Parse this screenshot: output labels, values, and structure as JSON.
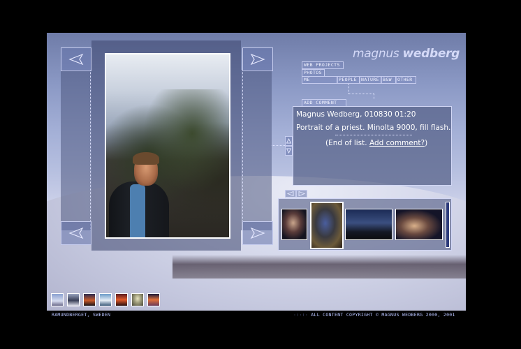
{
  "logo": {
    "first": "magnus",
    "last": "wedberg"
  },
  "nav": {
    "web_projects": "WEB PROJECTS",
    "photos": "PHOTOS",
    "me": "ME",
    "people": "PEOPLE",
    "nature": "NATURE",
    "bw": "B&W",
    "other": "OTHER",
    "add_comment": "ADD COMMENT"
  },
  "comment": {
    "author_date": "Magnus Wedberg, 010830 01:20",
    "text": "Portrait of a priest. Minolta 9000, fill flash.",
    "end_prefix": "(End of list. ",
    "add_link": "Add comment?",
    "end_suffix": ")"
  },
  "footer": {
    "location": "RAMUNDBERGET, SWEDEN",
    "copyright": "ALL CONTENT COPYRIGHT © MAGNUS WEDBERG 2000, 2001"
  },
  "colors": {
    "background": "#000000",
    "panel": "#5a6690",
    "text": "#ffffff",
    "link_border": "#c6ccee",
    "caption": "#b8c3ff"
  },
  "icons": {
    "prev": "arrow-left-icon",
    "next": "arrow-right-icon",
    "scroll_up": "arrow-up-icon",
    "scroll_down": "arrow-down-icon"
  }
}
